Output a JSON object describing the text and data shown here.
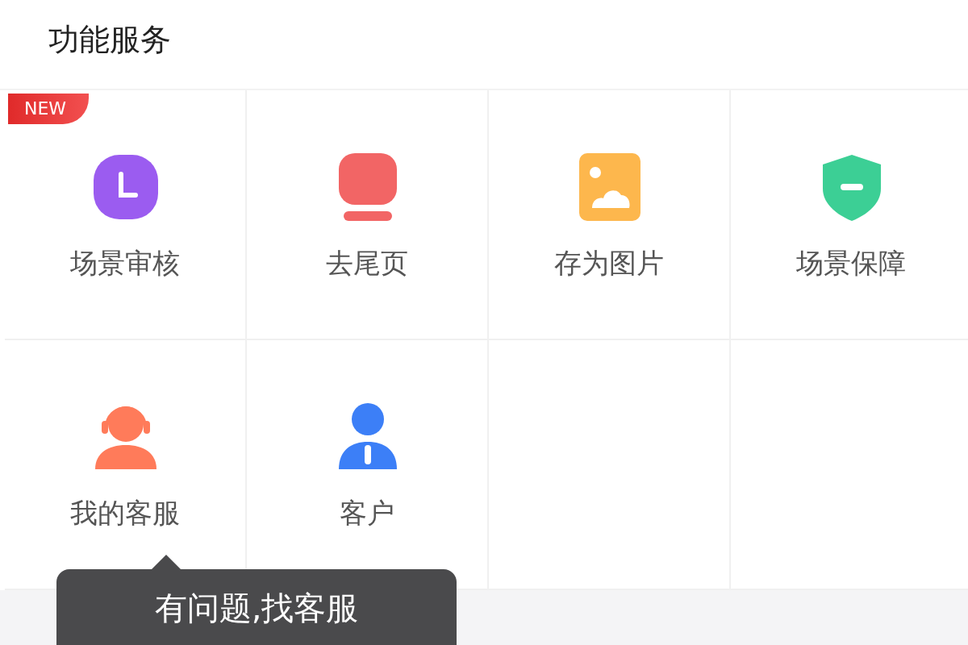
{
  "header": {
    "title": "功能服务"
  },
  "services": [
    {
      "label": "场景审核",
      "kind": "clock",
      "badge": "NEW"
    },
    {
      "label": "去尾页",
      "kind": "screen"
    },
    {
      "label": "存为图片",
      "kind": "image"
    },
    {
      "label": "场景保障",
      "kind": "shield"
    },
    {
      "label": "我的客服",
      "kind": "headset"
    },
    {
      "label": "客户",
      "kind": "person"
    }
  ],
  "tooltip": {
    "text": "有问题,找客服"
  }
}
